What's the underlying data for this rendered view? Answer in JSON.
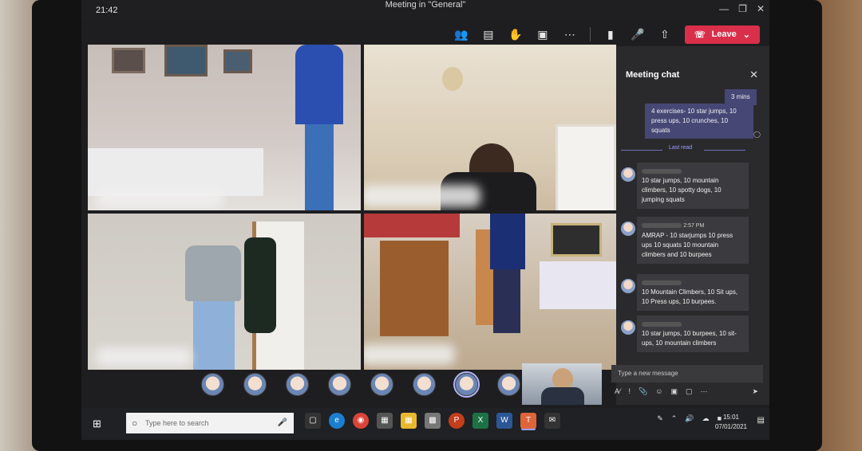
{
  "window": {
    "time": "21:42",
    "title": "Meeting in \"General\"",
    "leave_label": "Leave"
  },
  "toolbar": {
    "icons": [
      "participants-icon",
      "chat-icon",
      "raise-hand-icon",
      "breakout-icon",
      "more-icon",
      "camera-icon",
      "mic-icon",
      "share-icon"
    ]
  },
  "chat": {
    "title": "Meeting chat",
    "my_messages": [
      {
        "text": "3 mins"
      },
      {
        "text": "4 exercises- 10 star jumps, 10 press ups, 10 crunches, 10 squats"
      }
    ],
    "last_read_label": "Last read",
    "messages": [
      {
        "time": "",
        "text": "10 star jumps, 10 mountain climbers, 10 spotty dogs, 10 jumping squats"
      },
      {
        "time": "2:57 PM",
        "text": "AMRAP - 10 starjumps 10 press ups 10 squats 10 mountain climbers and 10 burpees"
      },
      {
        "time": "",
        "text": "10 Mountain Climbers, 10 Sit ups, 10 Press ups, 10 burpees."
      },
      {
        "time": "",
        "text": "10 star jumps, 10 burpees, 10 sit-ups, 10 mountain climbers"
      }
    ],
    "compose_placeholder": "Type a new message"
  },
  "taskbar": {
    "search_placeholder": "Type here to search",
    "time": "15:01",
    "date": "07/01/2021"
  },
  "colors": {
    "leave": "#d92f4b",
    "teams_purple": "#464775"
  }
}
